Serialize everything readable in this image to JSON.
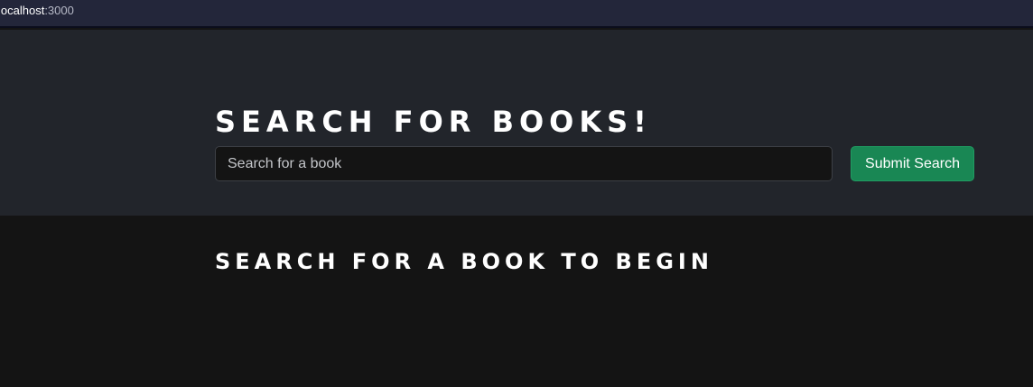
{
  "browser": {
    "url_host": "localhost",
    "url_port": ":3000"
  },
  "hero": {
    "title": "SEARCH FOR BOOKS!",
    "search_placeholder": "Search for a book",
    "search_value": "",
    "submit_label": "Submit Search"
  },
  "results": {
    "empty_message": "SEARCH FOR A BOOK TO BEGIN"
  },
  "colors": {
    "topbar": "#23263a",
    "hero_bg": "#22252b",
    "page_bg": "#141414",
    "submit_button": "#198754"
  }
}
